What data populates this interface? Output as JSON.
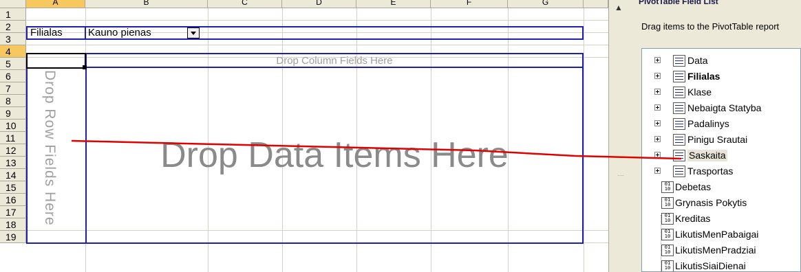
{
  "sheet": {
    "columns": [
      "A",
      "B",
      "C",
      "D",
      "E",
      "F",
      "G"
    ],
    "rows": [
      "1",
      "2",
      "3",
      "4",
      "5",
      "6",
      "7",
      "8",
      "9",
      "10",
      "11",
      "12",
      "13",
      "14",
      "15",
      "16",
      "17",
      "18",
      "19"
    ],
    "page_field_label": "Filialas",
    "page_field_value": "Kauno pienas",
    "drop_column_hint": "Drop Column Fields Here",
    "drop_row_hint": "Drop Row Fields Here",
    "drop_data_hint": "Drop Data Items Here"
  },
  "panel": {
    "title": "PivotTable Field List",
    "description": "Drag items to the PivotTable report",
    "dimension_fields": [
      "Data",
      "Filialas",
      "Klase",
      "Nebaigta Statyba",
      "Padalinys",
      "Pinigu Srautai",
      "Saskaita",
      "Trasportas"
    ],
    "data_fields": [
      "Debetas",
      "Grynasis Pokytis",
      "Kreditas",
      "LikutisMenPabaigai",
      "LikutisMenPradziai",
      "LikutisSiaiDienai"
    ]
  },
  "colors": {
    "border_blue": "#1f1fb4",
    "annotation_red": "#e00000",
    "selected_header": "#f7c860"
  }
}
